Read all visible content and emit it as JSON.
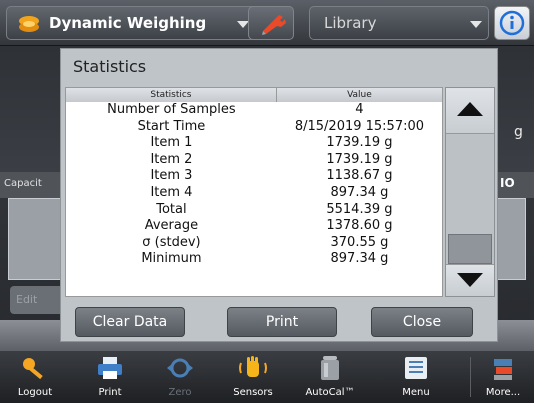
{
  "header": {
    "app_title": "Dynamic Weighing",
    "library_label": "Library",
    "info_icon": "info-icon",
    "wrench_icon": "wrench-icon"
  },
  "background": {
    "unit": "g",
    "capacity_label": "Capacit",
    "capacity_right": "IO",
    "edit_label": "Edit"
  },
  "dialog": {
    "title": "Statistics",
    "table": {
      "columns": [
        "Statistics",
        "Value"
      ],
      "rows": [
        {
          "label": "Number of Samples",
          "value": "4"
        },
        {
          "label": "Start Time",
          "value": "8/15/2019 15:57:00"
        },
        {
          "label": "Item 1",
          "value": "1739.19 g"
        },
        {
          "label": "Item 2",
          "value": "1739.19 g"
        },
        {
          "label": "Item 3",
          "value": "1138.67 g"
        },
        {
          "label": "Item 4",
          "value": "897.34 g"
        },
        {
          "label": "Total",
          "value": "5514.39 g"
        },
        {
          "label": "Average",
          "value": "1378.60 g"
        },
        {
          "label": "σ (stdev)",
          "value": "370.55 g"
        },
        {
          "label": "Minimum",
          "value": "897.34 g"
        }
      ]
    },
    "buttons": {
      "clear": "Clear Data",
      "print": "Print",
      "close": "Close"
    }
  },
  "toolbar": {
    "items": [
      {
        "label": "Logout",
        "icon": "key-icon"
      },
      {
        "label": "Print",
        "icon": "printer-icon"
      },
      {
        "label": "Zero",
        "icon": "zero-icon"
      },
      {
        "label": "Sensors",
        "icon": "hand-sensor-icon"
      },
      {
        "label": "AutoCal™",
        "icon": "weight-icon"
      },
      {
        "label": "Menu",
        "icon": "menu-icon"
      },
      {
        "label": "More...",
        "icon": "more-icon"
      }
    ]
  },
  "colors": {
    "accent_icon_orange": "#f5a623",
    "info_blue": "#1e6fd9"
  }
}
